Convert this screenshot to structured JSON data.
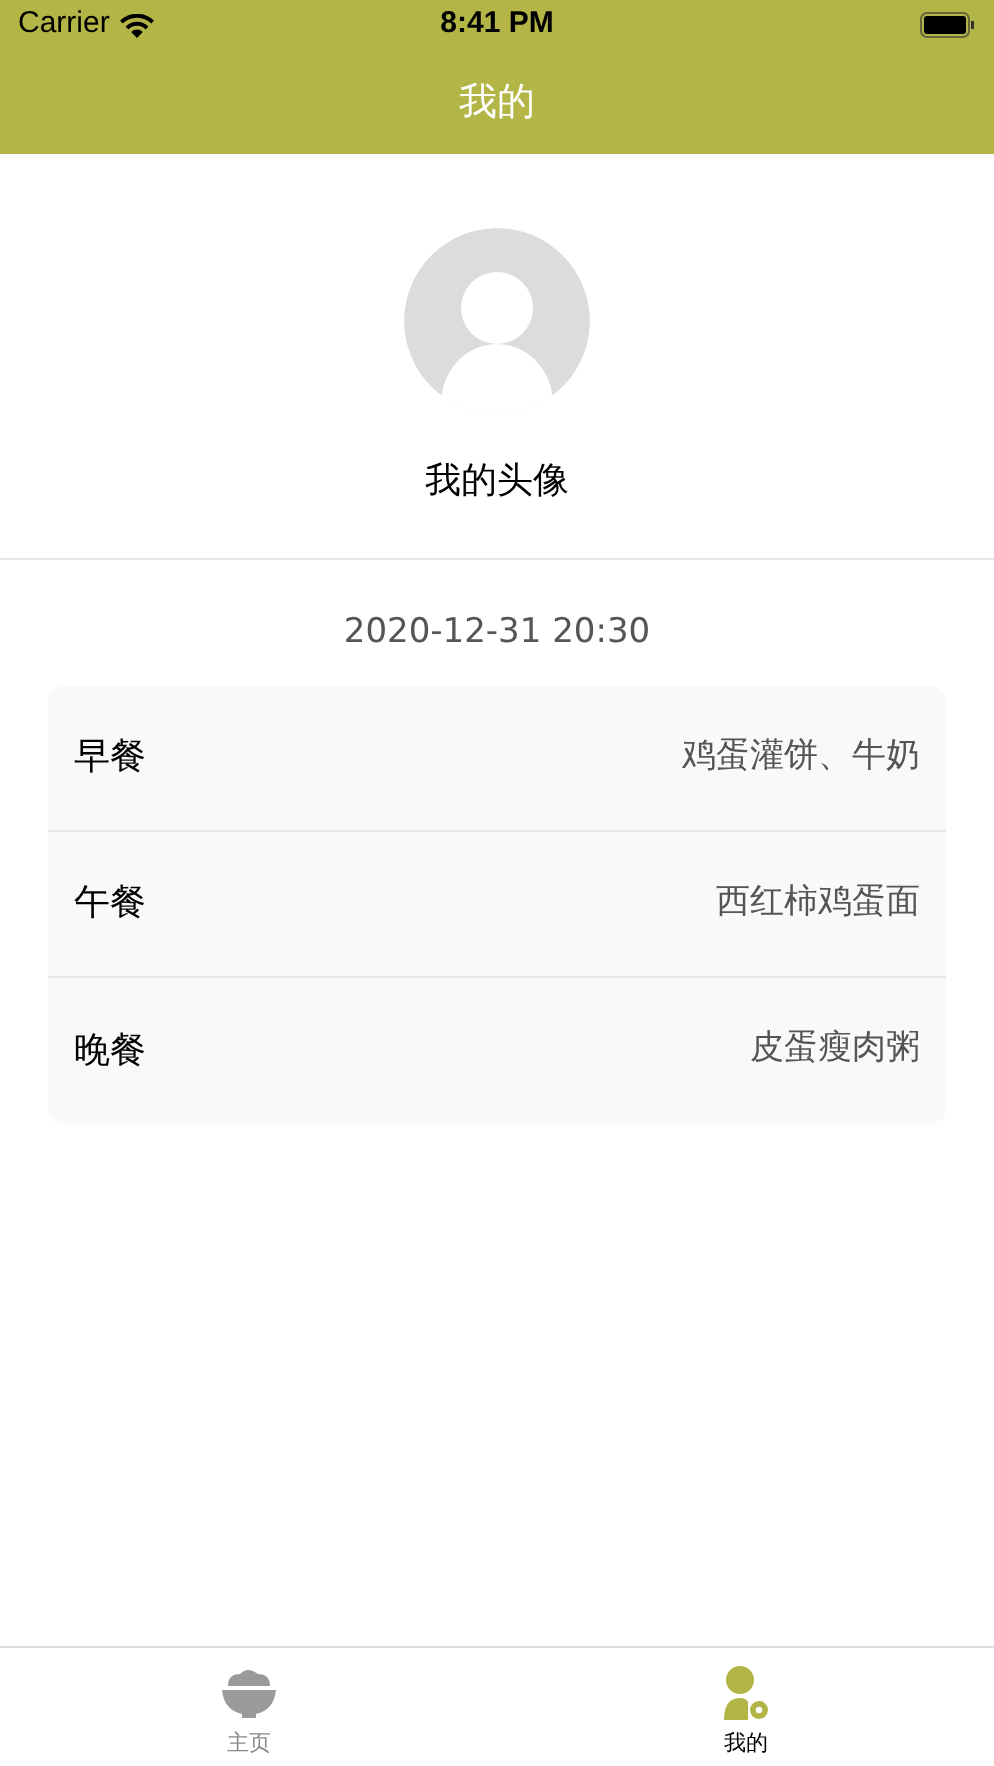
{
  "status_bar": {
    "carrier": "Carrier",
    "time": "8:41 PM"
  },
  "nav": {
    "title": "我的"
  },
  "profile": {
    "avatar_label": "我的头像"
  },
  "date": "2020-12-31  20:30",
  "meals": [
    {
      "label": "早餐",
      "value": "鸡蛋灌饼、牛奶"
    },
    {
      "label": "午餐",
      "value": "西红柿鸡蛋面"
    },
    {
      "label": "晚餐",
      "value": "皮蛋瘦肉粥"
    }
  ],
  "tabs": [
    {
      "kind": "bowl",
      "label": "主页",
      "selected": false
    },
    {
      "kind": "person",
      "label": "我的",
      "selected": true
    }
  ]
}
